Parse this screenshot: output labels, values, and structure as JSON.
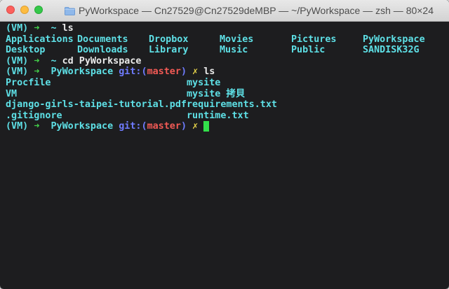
{
  "window": {
    "title": "PyWorkspace — Cn27529@Cn27529deMBP — ~/PyWorkspace — zsh — 80×24"
  },
  "lines": [
    {
      "env": "(VM)",
      "arrow": "➜",
      "dir": "~",
      "cmd": "ls"
    },
    {
      "cols": [
        "Applications",
        "Documents",
        "Dropbox",
        "Movies",
        "Pictures",
        "PyWorkspace"
      ]
    },
    {
      "cols": [
        "Desktop",
        "Downloads",
        "Library",
        "Music",
        "Public",
        "SANDISK32G"
      ]
    },
    {
      "env": "(VM)",
      "arrow": "➜",
      "dir": "~",
      "cmd": "cd PyWorkspace"
    },
    {
      "env": "(VM)",
      "arrow": "➜",
      "dir": "PyWorkspace",
      "git": "git:(",
      "branch": "master",
      "gitclose": ")",
      "dirty": "✗",
      "cmd": "ls"
    },
    {
      "cols": [
        "Procfile",
        "mysite"
      ]
    },
    {
      "cols": [
        "VM",
        "mysite 拷貝"
      ]
    },
    {
      "cols": [
        "django-girls-taipei-tutorial.pdf",
        "requirements.txt"
      ]
    },
    {
      "cols": [
        ".gitignore",
        "runtime.txt"
      ]
    },
    {
      "env": "(VM)",
      "arrow": "➜",
      "dir": "PyWorkspace",
      "git": "git:(",
      "branch": "master",
      "gitclose": ")",
      "dirty": "✗",
      "cmd": ""
    }
  ],
  "colors": {
    "cyan": "#5ee0e6",
    "green": "#43d04a",
    "blue": "#6f7cff",
    "red": "#f25a55",
    "yellow": "#e7d44a",
    "cursor": "#32e04a"
  }
}
